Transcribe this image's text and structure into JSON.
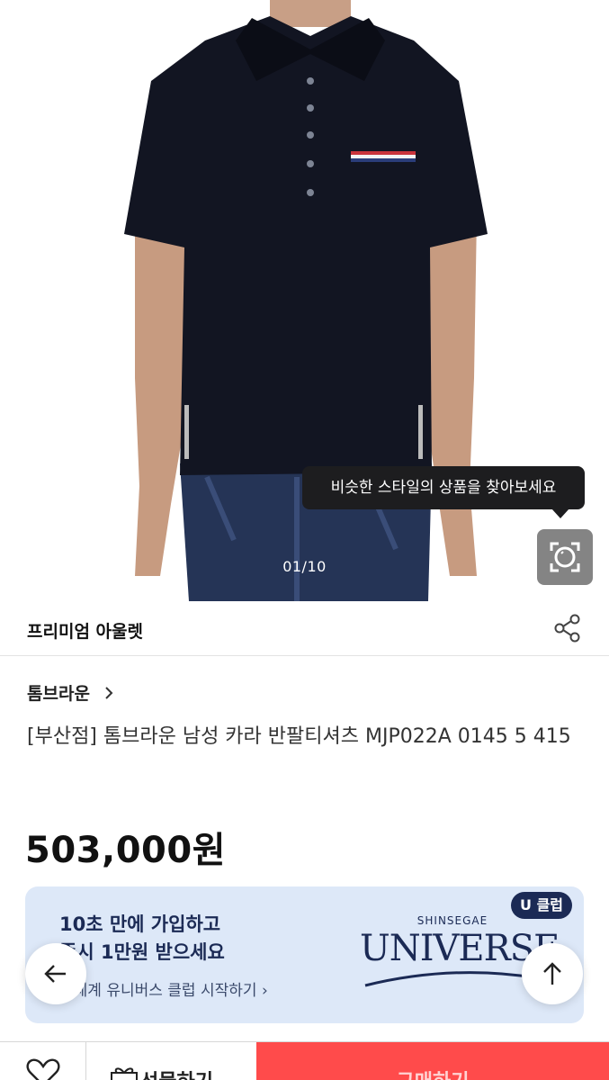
{
  "gallery": {
    "counter": "01/10",
    "similar_tooltip": "비슷한 스타일의 상품을 찾아보세요",
    "lens_icon": "camera-lens-icon"
  },
  "shop": {
    "name": "프리미엄 아울렛",
    "share_icon": "share-icon"
  },
  "product": {
    "brand": "톰브라운",
    "title": "[부산점] 톰브라운 남성 카라 반팔티셔츠 MJP022A 0145 5 415",
    "price": "503,000원"
  },
  "banner": {
    "line1": "10초 만에 가입하고",
    "line2": "즉시 1만원 받으세요",
    "link": "신세계 유니버스 클럽 시작하기",
    "badge": "U 클럽",
    "brand_top": "SHINSEGAE",
    "brand_main": "UNIVERSE",
    "background": "#dde8f8"
  },
  "actions": {
    "gift_label": "선물하기",
    "buy_label": "구매하기",
    "buy_color": "#ff4b4b"
  }
}
